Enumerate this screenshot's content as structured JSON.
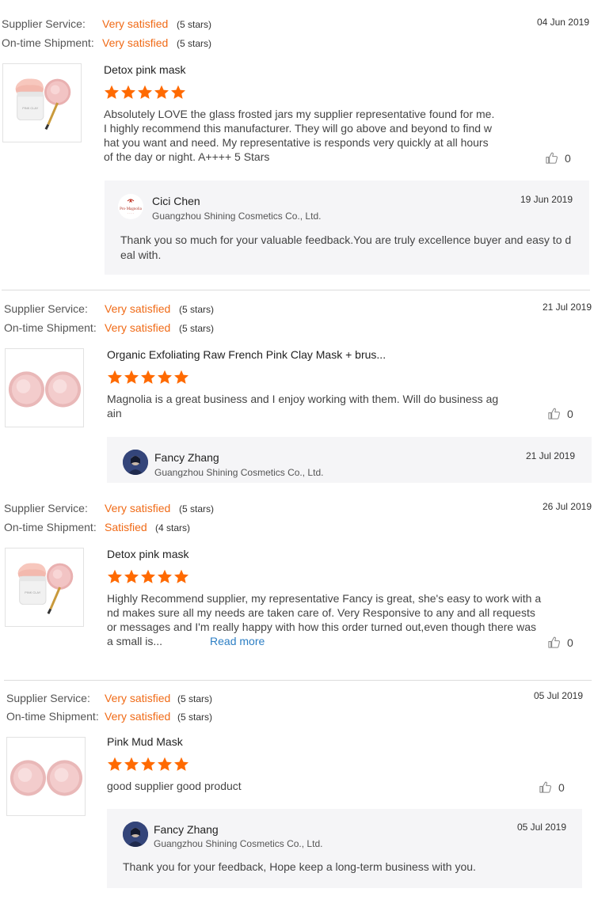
{
  "colors": {
    "accent": "#f06a16",
    "star": "#ff6a00",
    "link": "#2d7fc4",
    "reply_bg": "#f5f5f7"
  },
  "labels": {
    "supplier_service": "Supplier Service:",
    "on_time_shipment": "On-time Shipment:",
    "read_more": "Read more"
  },
  "reviews": [
    {
      "date": "04 Jun 2019",
      "supplier_value": "Very satisfied",
      "supplier_stars": "(5 stars)",
      "shipment_value": "Very satisfied",
      "shipment_stars": "(5 stars)",
      "product_title": "Detox pink mask",
      "star_rating": 5,
      "comment": "Absolutely LOVE the glass frosted jars my supplier representative found for me. I highly recommend this manufacturer. They will go above and beyond to find what you want and need. My representative is responds very quickly at all hours of the day or night. A++++ 5 Stars",
      "likes": "0",
      "reply": {
        "name": "Cici Chen",
        "company": "Guangzhou Shining Cosmetics Co., Ltd.",
        "date": "19 Jun 2019",
        "text": "Thank you so much for your valuable feedback.You are truly excellence buyer and easy to deal with."
      }
    },
    {
      "date": "21 Jul 2019",
      "supplier_value": "Very satisfied",
      "supplier_stars": "(5 stars)",
      "shipment_value": "Very satisfied",
      "shipment_stars": "(5 stars)",
      "product_title": "Organic Exfoliating Raw French Pink Clay Mask + brus...",
      "star_rating": 5,
      "comment": "Magnolia is a great business and I enjoy working with them. Will do business again",
      "likes": "0",
      "reply": {
        "name": "Fancy Zhang",
        "company": "Guangzhou Shining Cosmetics Co., Ltd.",
        "date": "21 Jul 2019",
        "text": ""
      }
    },
    {
      "date": "26 Jul 2019",
      "supplier_value": "Very satisfied",
      "supplier_stars": "(5 stars)",
      "shipment_value": "Satisfied",
      "shipment_stars": "(4 stars)",
      "product_title": "Detox pink mask",
      "star_rating": 5,
      "comment": "Highly Recommend supplier, my representative Fancy is great, she's easy to work with and makes sure all my needs are taken care of. Very Responsive to any and all requests or messages and I'm really happy with how this order turned out,even though there was a small is...",
      "likes": "0"
    },
    {
      "date": "05 Jul 2019",
      "supplier_value": "Very satisfied",
      "supplier_stars": "(5 stars)",
      "shipment_value": "Very satisfied",
      "shipment_stars": "(5 stars)",
      "product_title": "Pink Mud Mask",
      "star_rating": 5,
      "comment": "good supplier good product",
      "likes": "0",
      "reply": {
        "name": "Fancy Zhang",
        "company": "Guangzhou Shining Cosmetics Co., Ltd.",
        "date": "05 Jul 2019",
        "text": "Thank you for your feedback, Hope keep a long-term business with you."
      }
    }
  ]
}
